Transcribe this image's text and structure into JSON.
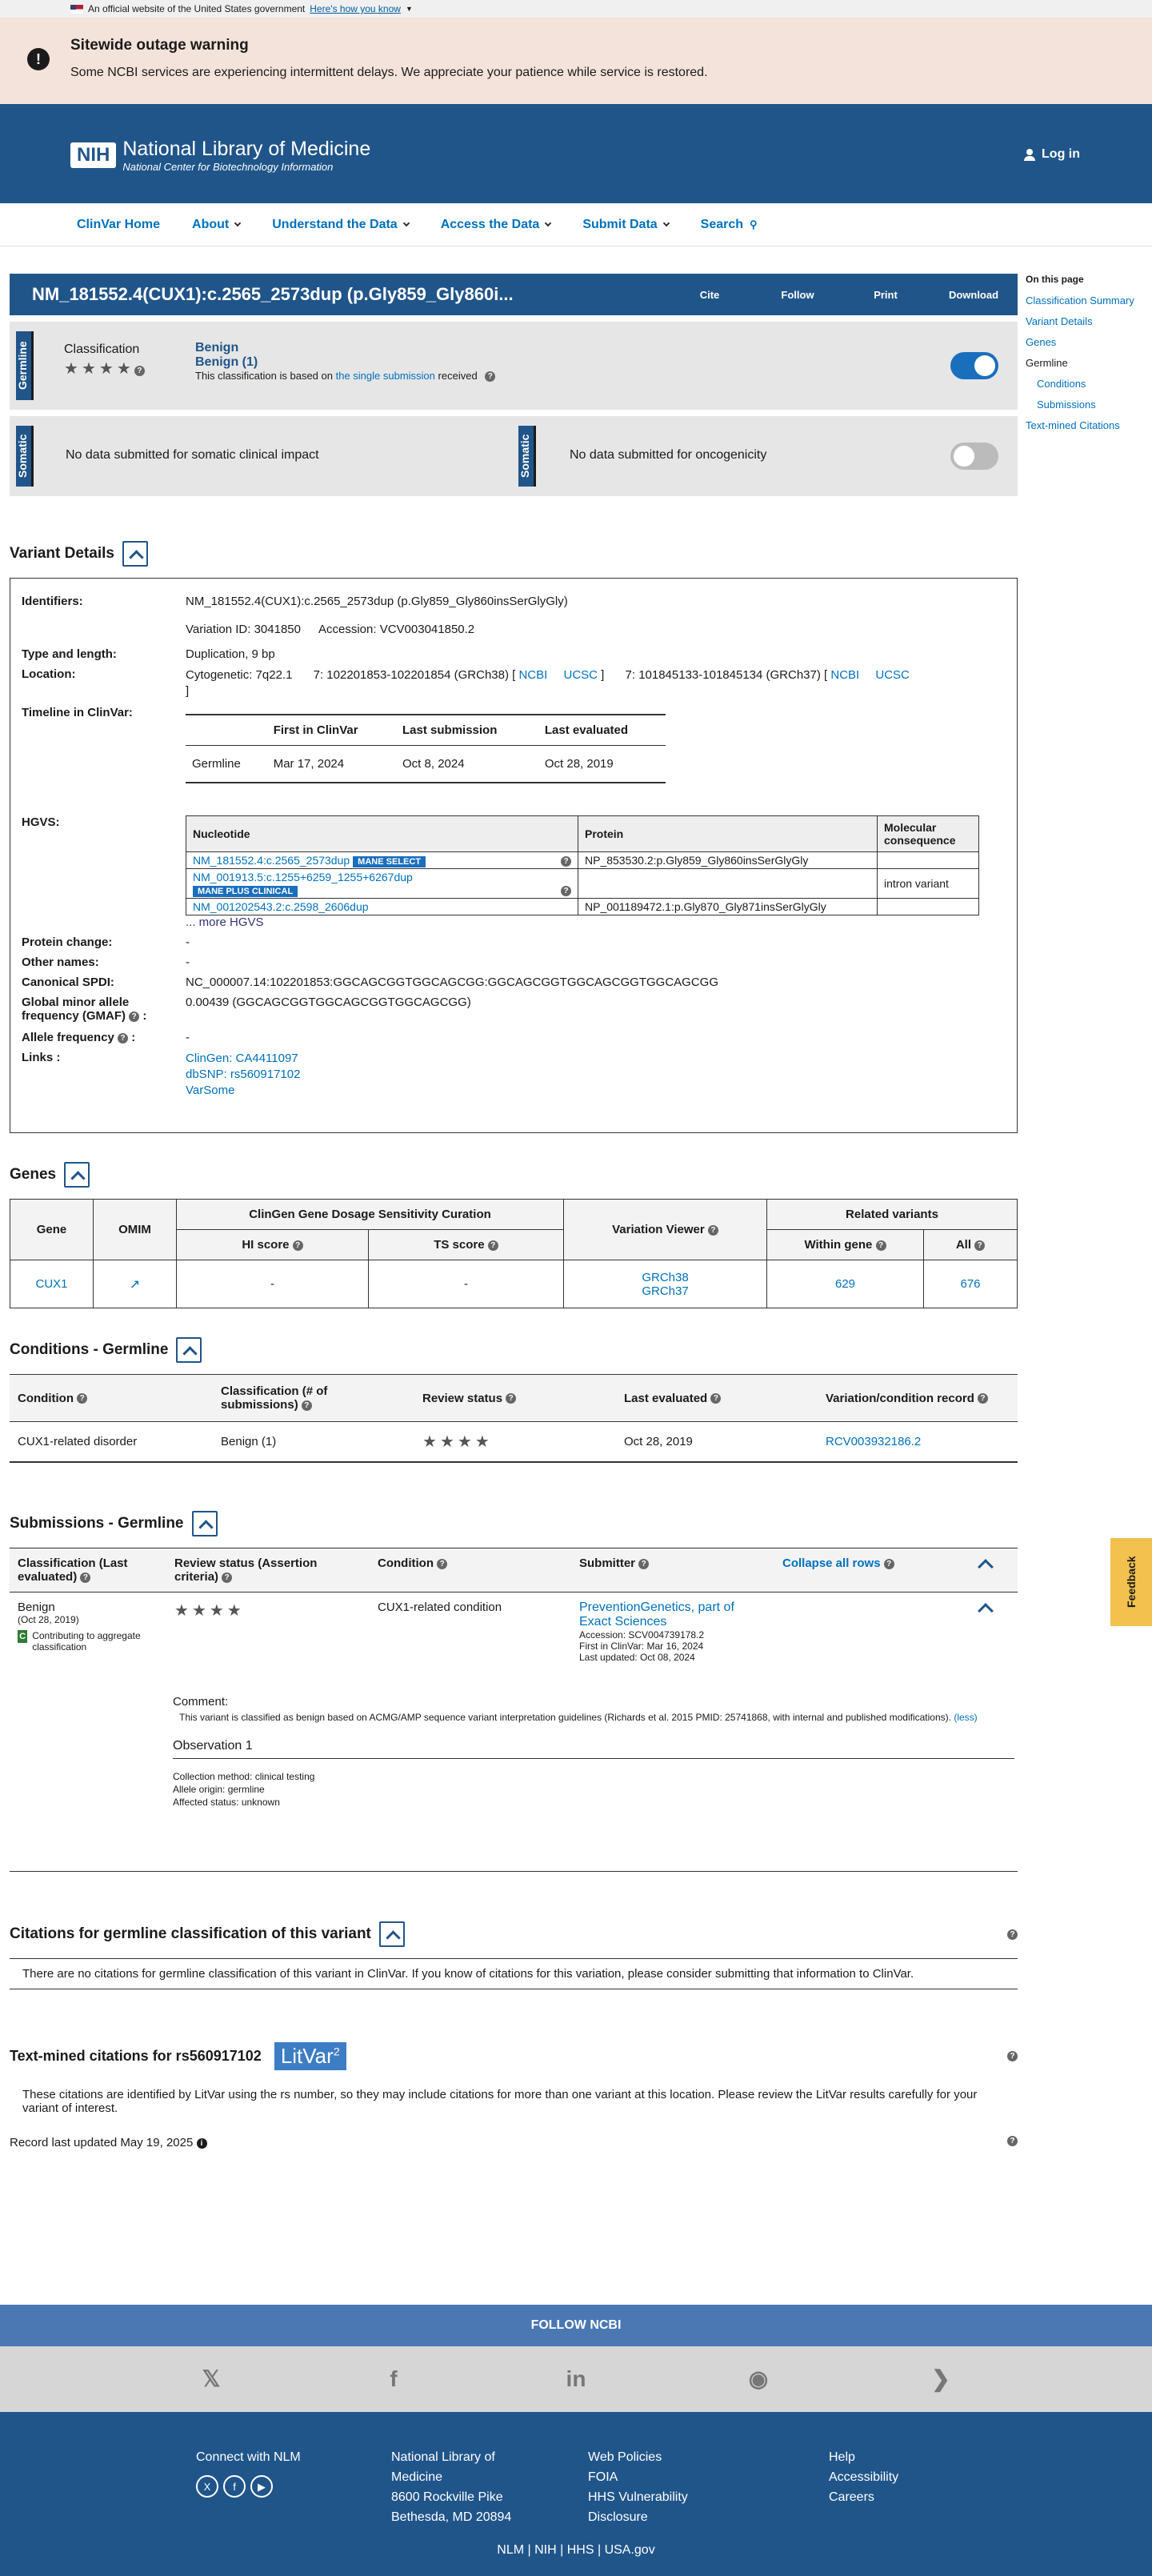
{
  "gov_banner": {
    "text": "An official website of the United States government",
    "link": "Here's how you know"
  },
  "outage": {
    "title": "Sitewide outage warning",
    "text": "Some NCBI services are experiencing intermittent delays. We appreciate your patience while service is restored."
  },
  "header": {
    "logo_abbr": "NIH",
    "logo_title": "National Library of Medicine",
    "logo_sub": "National Center for Biotechnology Information",
    "login": "Log in"
  },
  "nav": [
    "ClinVar Home",
    "About",
    "Understand the Data",
    "Access the Data",
    "Submit Data",
    "Search"
  ],
  "title_bar": {
    "title": "NM_181552.4(CUX1):c.2565_2573dup (p.Gly859_Gly860i...",
    "actions": [
      "Cite",
      "Follow",
      "Print",
      "Download"
    ]
  },
  "germline": {
    "tab": "Germline",
    "label": "Classification",
    "class1": "Benign",
    "class2": "Benign (1)",
    "basis_pre": "This classification is based on",
    "basis_link": "the single submission",
    "basis_post": "received"
  },
  "somatic": {
    "tab": "Somatic",
    "clinical": "No data submitted for somatic clinical impact",
    "onco": "No data submitted for oncogenicity"
  },
  "sidebar": {
    "heading": "On this page",
    "items": [
      "Classification Summary",
      "Variant Details",
      "Genes",
      "Germline",
      "Conditions",
      "Submissions",
      "Text-mined Citations"
    ]
  },
  "variant_details": {
    "heading": "Variant Details",
    "identifiers_k": "Identifiers:",
    "identifiers_v": "NM_181552.4(CUX1):c.2565_2573dup (p.Gly859_Gly860insSerGlyGly)",
    "variation_id": "Variation ID: 3041850",
    "accession": "Accession: VCV003041850.2",
    "type_k": "Type and length:",
    "type_v": "Duplication, 9 bp",
    "location_k": "Location:",
    "cyto": "Cytogenetic: 7q22.1",
    "grch38": "7: 102201853-102201854 (GRCh38) [",
    "grch37": "7: 101845133-101845134 (GRCh37) [",
    "ncbi": "NCBI",
    "ucsc": "UCSC",
    "rb": "]",
    "timeline_k": "Timeline in ClinVar:",
    "timeline_headers": [
      "First in ClinVar",
      "Last submission",
      "Last evaluated"
    ],
    "timeline_row": [
      "Germline",
      "Mar 17, 2024",
      "Oct 8, 2024",
      "Oct 28, 2019"
    ],
    "hgvs_k": "HGVS:",
    "hgvs_headers": [
      "Nucleotide",
      "Protein",
      "Molecular consequence"
    ],
    "hgvs_rows": [
      {
        "nuc": "NM_181552.4:c.2565_2573dup",
        "badge": "MANE SELECT",
        "prot": "NP_853530.2:p.Gly859_Gly860insSerGlyGly",
        "cons": ""
      },
      {
        "nuc": "NM_001913.5:c.1255+6259_1255+6267dup",
        "badge": "MANE PLUS CLINICAL",
        "prot": "",
        "cons": "intron variant"
      },
      {
        "nuc": "NM_001202543.2:c.2598_2606dup",
        "badge": "",
        "prot": "NP_001189472.1:p.Gly870_Gly871insSerGlyGly",
        "cons": ""
      }
    ],
    "more_hgvs": "... more HGVS",
    "protein_change_k": "Protein change:",
    "protein_change_v": "-",
    "other_names_k": "Other names:",
    "other_names_v": "-",
    "spdi_k": "Canonical SPDI:",
    "spdi_v": "NC_000007.14:102201853:GGCAGCGGTGGCAGCGG:GGCAGCGGTGGCAGCGGTGGCAGCGG",
    "gmaf_k": "Global minor allele frequency (GMAF)",
    "gmaf_v": "0.00439 (GGCAGCGGTGGCAGCGGTGGCAGCGG)",
    "af_k": "Allele frequency",
    "af_v": "-",
    "links_k": "Links :",
    "links": [
      "ClinGen: CA4411097",
      "dbSNP: rs560917102",
      "VarSome"
    ]
  },
  "genes": {
    "heading": "Genes",
    "headers": [
      "Gene",
      "OMIM",
      "ClinGen Gene Dosage Sensitivity Curation",
      "Variation Viewer",
      "Related variants"
    ],
    "subheaders": [
      "HI score",
      "TS score",
      "Within gene",
      "All"
    ],
    "row": {
      "gene": "CUX1",
      "hi": "-",
      "ts": "-",
      "v38": "GRCh38",
      "v37": "GRCh37",
      "within": "629",
      "all": "676"
    }
  },
  "conditions": {
    "heading": "Conditions - Germline",
    "headers": [
      "Condition",
      "Classification (# of submissions)",
      "Review status",
      "Last evaluated",
      "Variation/condition record"
    ],
    "row": [
      "CUX1-related disorder",
      "Benign (1)",
      "",
      "Oct 28, 2019",
      "RCV003932186.2"
    ]
  },
  "submissions": {
    "heading": "Submissions - Germline",
    "headers": [
      "Classification (Last evaluated)",
      "Review status (Assertion criteria)",
      "Condition",
      "Submitter"
    ],
    "collapse_all": "Collapse all rows",
    "row": {
      "class": "Benign",
      "date": "(Oct 28, 2019)",
      "contrib": "Contributing to aggregate classification",
      "condition": "CUX1-related condition",
      "submitter": "PreventionGenetics, part of Exact Sciences",
      "accession": "Accession: SCV004739178.2",
      "first": "First in ClinVar: Mar 16, 2024",
      "updated": "Last updated: Oct 08, 2024"
    },
    "comment_label": "Comment:",
    "comment": "This variant is classified as benign based on ACMG/AMP sequence variant interpretation guidelines (Richards et al. 2015 PMID: 25741868, with internal and published modifications).",
    "less": "(less)",
    "obs": "Observation 1",
    "obs_lines": [
      "Collection method: clinical testing",
      "Allele origin: germline",
      "Affected status: unknown"
    ]
  },
  "citations": {
    "heading": "Citations for germline classification of this variant",
    "text": "There are no citations for germline classification of this variant in ClinVar. If you know of citations for this variation, please consider submitting that information to ClinVar."
  },
  "textmined": {
    "heading": "Text-mined citations for rs560917102",
    "litvar": "LitVar",
    "litvar_sup": "2",
    "text": "These citations are identified by LitVar using the rs number, so they may include citations for more than one variant at this location. Please review the LitVar results carefully for your variant of interest."
  },
  "record_updated": "Record last updated May 19, 2025",
  "feedback": "Feedback",
  "footer": {
    "follow": "FOLLOW NCBI",
    "connect": "Connect with NLM",
    "nlm": [
      "National Library of",
      "Medicine",
      "8600 Rockville Pike",
      "Bethesda, MD 20894"
    ],
    "policies": [
      "Web Policies",
      "FOIA",
      "HHS Vulnerability",
      "Disclosure"
    ],
    "help": [
      "Help",
      "Accessibility",
      "Careers"
    ],
    "bottom": [
      "NLM",
      "NIH",
      "HHS",
      "USA.gov"
    ]
  }
}
